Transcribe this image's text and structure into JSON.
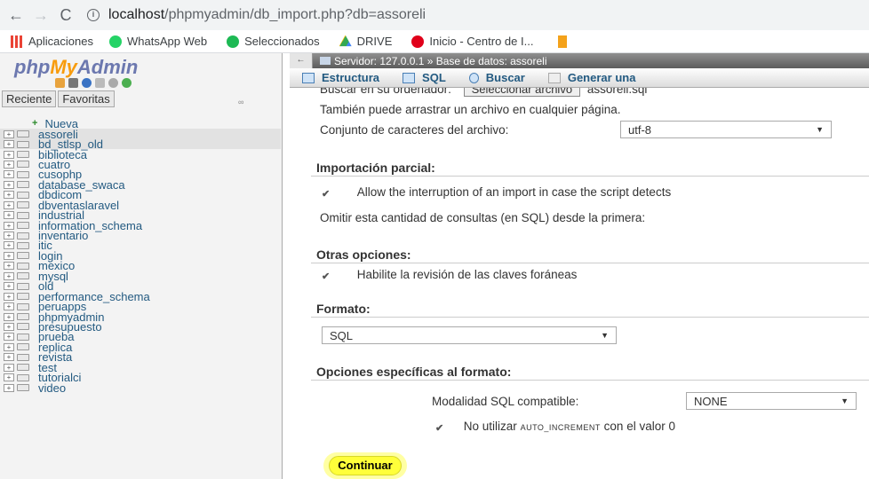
{
  "browser": {
    "url_host": "localhost",
    "url_path": "/phpmyadmin/db_import.php?db=assoreli",
    "bookmarks": [
      "Aplicaciones",
      "WhatsApp Web",
      "Seleccionados",
      "DRIVE",
      "Inicio - Centro de I..."
    ]
  },
  "sidebar": {
    "logo_php": "php",
    "logo_my": "My",
    "logo_admin": "Admin",
    "tabs": [
      "Reciente",
      "Favoritas"
    ],
    "new_label": "Nueva",
    "databases": [
      "assoreli",
      "bd_stlsp_old",
      "biblioteca",
      "cuatro",
      "cusophp",
      "database_swaca",
      "dbdicom",
      "dbventaslaravel",
      "industrial",
      "information_schema",
      "inventario",
      "itic",
      "login",
      "mexico",
      "mysql",
      "old",
      "performance_schema",
      "peruapps",
      "phpmyadmin",
      "presupuesto",
      "prueba",
      "replica",
      "revista",
      "test",
      "tutorialci",
      "video"
    ]
  },
  "header": {
    "breadcrumb": "Servidor: 127.0.0.1 » Base de datos: assoreli",
    "tabs": [
      "Estructura",
      "SQL",
      "Buscar",
      "Generar una"
    ]
  },
  "main": {
    "file_label": "Buscar en su ordenador:",
    "file_button": "Seleccionar archivo",
    "file_name": "assoreli.sql",
    "drag_hint": "También puede arrastrar un archivo en cualquier página.",
    "charset_label": "Conjunto de caracteres del archivo:",
    "charset_value": "utf-8",
    "partial_title": "Importación parcial:",
    "allow_interrupt": "Allow the interruption of an import in case the script detects",
    "skip_queries": "Omitir esta cantidad de consultas (en SQL) desde la primera:",
    "other_title": "Otras opciones:",
    "foreign_keys": "Habilite la revisión de las claves foráneas",
    "format_title": "Formato:",
    "format_value": "SQL",
    "format_options_title": "Opciones específicas al formato:",
    "sql_mode_label": "Modalidad SQL compatible:",
    "sql_mode_value": "NONE",
    "no_autoinc_prefix": "No utilizar",
    "no_autoinc_code": "AUTO_INCREMENT",
    "no_autoinc_suffix": "con el valor 0",
    "submit": "Continuar"
  },
  "colors": {
    "accent": "#235a81",
    "highlight": "#ffff3a"
  }
}
